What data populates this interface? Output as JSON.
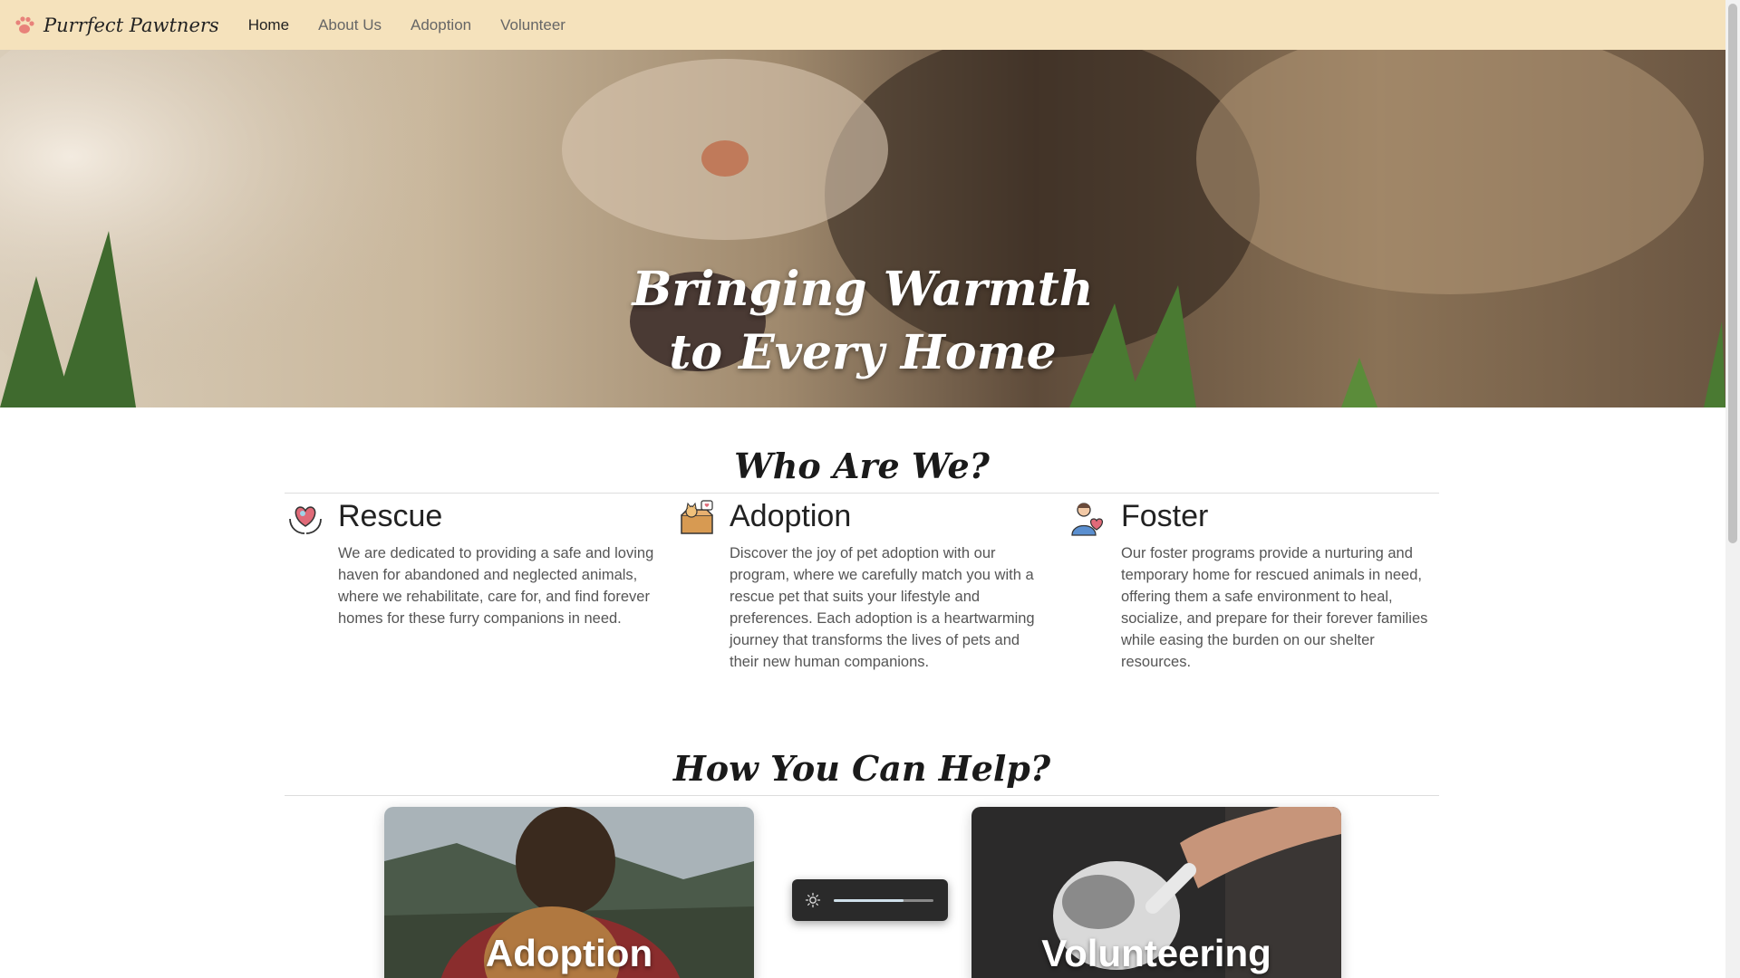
{
  "navbar": {
    "brand": "Purrfect Pawtners",
    "links": [
      "Home",
      "About Us",
      "Adoption",
      "Volunteer"
    ],
    "active": "Home"
  },
  "hero": {
    "title_line1": "Bringing Warmth",
    "title_line2": "to Every Home"
  },
  "who": {
    "title": "Who Are We?",
    "features": [
      {
        "icon": "rescue-heart-hands-icon",
        "heading": "Rescue",
        "text": "We are dedicated to providing a safe and loving haven for abandoned and neglected animals, where we rehabilitate, care for, and find forever homes for these furry companions in need."
      },
      {
        "icon": "adoption-box-icon",
        "heading": "Adoption",
        "text": "Discover the joy of pet adoption with our program, where we carefully match you with a rescue pet that suits your lifestyle and preferences. Each adoption is a heartwarming journey that transforms the lives of pets and their new human companions."
      },
      {
        "icon": "foster-person-icon",
        "heading": "Foster",
        "text": "Our foster programs provide a nurturing and temporary home for rescued animals in need, offering them a safe environment to heal, socialize, and prepare for their forever families while easing the burden on our shelter resources."
      }
    ]
  },
  "help": {
    "title": "How You Can Help?",
    "cards": [
      {
        "title": "Adoption"
      },
      {
        "title": "Volunteering"
      }
    ]
  },
  "brightness": {
    "level": 0.7
  }
}
